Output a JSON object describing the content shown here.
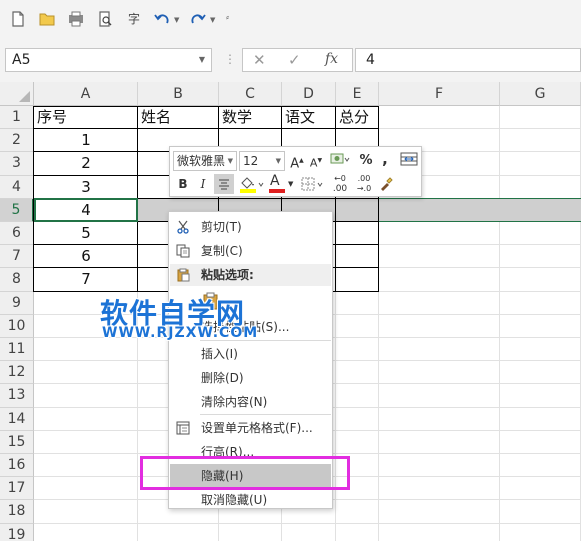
{
  "colors": {
    "accent": "#217346",
    "highlight_box": "#e22de0",
    "watermark": "#1c73d6",
    "font_color_bar": "#e02020",
    "fill_color_bar": "#ffff00"
  },
  "toolbar": {
    "icons": [
      "new-file-icon",
      "open-file-icon",
      "save-print-icon",
      "print-preview-icon",
      "spell-check-icon",
      "undo-icon",
      "redo-icon",
      "customize-icon"
    ],
    "spell_glyph": "字"
  },
  "formula_bar": {
    "name_box": "A5",
    "cancel": "✕",
    "enter": "✓",
    "fx": "fx",
    "value": "4"
  },
  "columns": [
    "A",
    "B",
    "C",
    "D",
    "E",
    "F",
    "G"
  ],
  "rows": [
    "1",
    "2",
    "3",
    "4",
    "5",
    "6",
    "7",
    "8",
    "9",
    "10",
    "11",
    "12",
    "13",
    "14",
    "15",
    "16",
    "17",
    "18",
    "19"
  ],
  "table": {
    "headers": [
      "序号",
      "姓名",
      "数学",
      "语文",
      "总分"
    ],
    "index_values": [
      "1",
      "2",
      "3",
      "4",
      "5",
      "6",
      "7"
    ]
  },
  "mini_toolbar": {
    "font_name": "微软雅黑",
    "font_size": "12",
    "grow_font": "A",
    "shrink_font": "A",
    "percent": "%",
    "comma": ",",
    "bold": "B",
    "italic": "I",
    "font_color_letter": "A",
    "increase_decimal": ".00",
    "decrease_decimal": ".00"
  },
  "context_menu": {
    "cut": "剪切(T)",
    "copy": "复制(C)",
    "paste_options": "粘贴选项:",
    "paste_special": "选择性粘贴(S)...",
    "insert": "插入(I)",
    "delete": "删除(D)",
    "clear": "清除内容(N)",
    "format_cells": "设置单元格格式(F)...",
    "row_height": "行高(R)...",
    "hide": "隐藏(H)",
    "unhide": "取消隐藏(U)"
  },
  "watermark": {
    "title": "软件自学网",
    "url": "WWW.RJZXW.COM"
  }
}
